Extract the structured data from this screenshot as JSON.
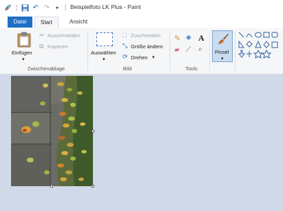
{
  "window": {
    "title": "Beispielfoto LK Plus - Paint"
  },
  "tabs": [
    "Datei",
    "Start",
    "Ansicht"
  ],
  "ribbon": {
    "clipboard": {
      "paste": "Einfügen",
      "cut": "Ausschneiden",
      "copy": "Kopieren",
      "group": "Zwischenablage"
    },
    "image": {
      "select": "Auswählen",
      "crop": "Zuschneiden",
      "resize": "Größe ändern",
      "rotate": "Drehen",
      "group": "Bild"
    },
    "tools": {
      "group": "Tools"
    },
    "brushes": {
      "label": "Pinsel"
    }
  },
  "colors": {
    "accent": "#1f6fc5",
    "workspace": "#cfd9e8",
    "ribbon": "#f5f6f7"
  }
}
